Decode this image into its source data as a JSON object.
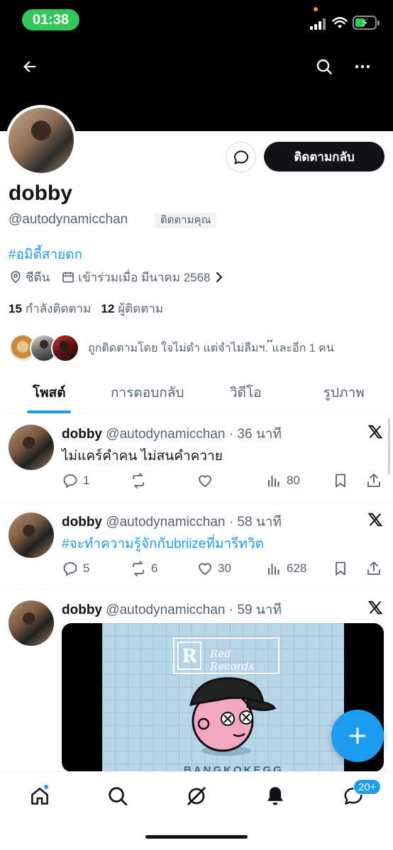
{
  "status_bar": {
    "time": "01:38"
  },
  "profile": {
    "display_name": "dobby",
    "handle": "@autodynamicchan",
    "follows_you": "ติดตามคุณ",
    "follow_back_label": "ติดตามกลับ",
    "bio": "#อมิตี้สายดก",
    "location": "ชีตีน",
    "joined": "เข้าร่วมเมื่อ มีนาคม 2568",
    "following_count": "15",
    "following_label": "กำลังติดตาม",
    "followers_count": "12",
    "followers_label": "ผู้ติดตาม",
    "followed_by_text": "ถูกติดตามโดย ใจไม่ดำ แต่จำไม่ลืมฯ. ๊และอีก 1 คน"
  },
  "tabs": [
    {
      "label": "โพสต์",
      "active": true
    },
    {
      "label": "การตอบกลับ",
      "active": false
    },
    {
      "label": "วิดีโอ",
      "active": false
    },
    {
      "label": "รูปภาพ",
      "active": false
    }
  ],
  "posts": [
    {
      "name": "dobby",
      "handle_time": "@autodynamicchan · 36 นาที",
      "text": "ไม่แคร์คำคน ไม่สนคำควาย",
      "replies": "1",
      "reposts": "",
      "likes": "",
      "views": "80"
    },
    {
      "name": "dobby",
      "handle_time": "@autodynamicchan · 58 นาที",
      "text": "#จะทำความรู้จักกับbriizeที่มารีทวิต",
      "replies": "5",
      "reposts": "6",
      "likes": "30",
      "views": "628"
    },
    {
      "name": "dobby",
      "handle_time": "@autodynamicchan · 59 นาที",
      "text": "",
      "media_text": "BANGKOKEGG"
    }
  ],
  "bottom_nav": {
    "messages_badge": "20+"
  },
  "colors": {
    "accent": "#1d9bf0",
    "text": "#0f1419",
    "secondary": "#536471",
    "status_green": "#34c759"
  },
  "icons": [
    "back-arrow-icon",
    "search-icon",
    "more-icon",
    "message-icon",
    "location-icon",
    "calendar-icon",
    "chevron-right-icon",
    "x-logo-icon",
    "reply-icon",
    "repost-icon",
    "like-icon",
    "views-icon",
    "bookmark-icon",
    "share-icon",
    "compose-icon",
    "home-icon",
    "grok-icon",
    "notifications-icon"
  ]
}
